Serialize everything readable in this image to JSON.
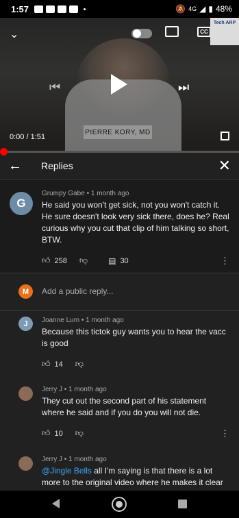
{
  "status_bar": {
    "time": "1:57",
    "network": "4G",
    "battery": "48%"
  },
  "video": {
    "nameplate": "PIERRE KORY, MD",
    "time_display": "0:00 / 1:51",
    "progress_fraction": 0.0,
    "cc_label": "CC",
    "watermark": "Tech ARP"
  },
  "replies_panel": {
    "title": "Replies"
  },
  "main_comment": {
    "avatar_letter": "G",
    "avatar_color": "#6f8ca7",
    "meta": "Grumpy Gabe • 1 month ago",
    "text": "He said you won't get sick, not you won't catch it. He sure doesn't look very sick there, does he? Real curious why you cut that clip of him talking so short, BTW.",
    "likes": "258",
    "replies": "30"
  },
  "reply_input": {
    "avatar_letter": "M",
    "avatar_color": "#e8711a",
    "placeholder": "Add a public reply..."
  },
  "replies": [
    {
      "avatar_letter": "J",
      "avatar_color": "#7e9bb6",
      "meta": "Joanne Lum • 1 month ago",
      "text": "Because this tictok guy wants you to hear the vacc is good",
      "likes": "14"
    },
    {
      "avatar_letter": "",
      "avatar_color": "#8a6b55",
      "meta": "Jerry J • 1 month ago",
      "text": "They cut out the second part of his statement where he said and if you do you will not die.",
      "likes": "10"
    },
    {
      "avatar_letter": "",
      "avatar_color": "#8a6b55",
      "meta": "Jerry J • 1 month ago",
      "mention": "@Jingle Bells",
      "text": " all I'm saying is that there is a lot more to the original video where he makes it clear"
    }
  ]
}
